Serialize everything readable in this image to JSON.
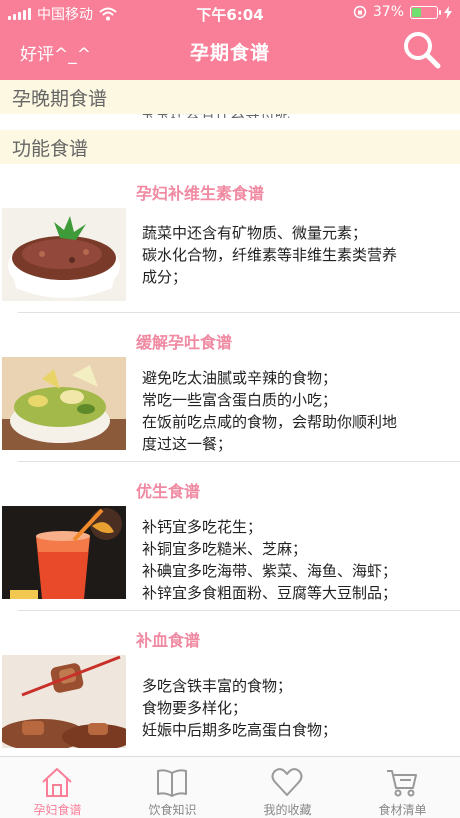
{
  "status_bar": {
    "carrier": "中国移动",
    "time": "下午6:04",
    "battery": "37%",
    "battery_level": 0.37
  },
  "nav": {
    "left_label": "好评^_^",
    "title": "孕期食谱",
    "search_icon": "search-icon"
  },
  "sections": [
    {
      "title": "孕晚期食谱",
      "peek": "宝宝还会有什么等待呢"
    },
    {
      "title": "功能食谱"
    }
  ],
  "items": [
    {
      "name": "孕妇补维生素食谱",
      "lines": [
        "蔬菜中还含有矿物质、微量元素；",
        "碳水化合物，纤维素等非维生素类营养",
        "成分；"
      ]
    },
    {
      "name": "缓解孕吐食谱",
      "lines": [
        "避免吃太油腻或辛辣的食物；",
        "常吃一些富含蛋白质的小吃；",
        "在饭前吃点咸的食物，会帮助你顺利地",
        "度过这一餐；"
      ]
    },
    {
      "name": "优生食谱",
      "lines": [
        "补钙宜多吃花生；",
        "补铜宜多吃糙米、芝麻；",
        "补碘宜多吃海带、紫菜、海鱼、海虾；",
        "补锌宜多食粗面粉、豆腐等大豆制品；"
      ]
    },
    {
      "name": "补血食谱",
      "lines": [
        "多吃含铁丰富的食物；",
        "食物要多样化；",
        "妊娠中后期多吃高蛋白食物；"
      ]
    }
  ],
  "tabs": [
    {
      "label": "孕妇食谱",
      "icon": "home-icon",
      "active": true
    },
    {
      "label": "饮食知识",
      "icon": "book-icon",
      "active": false
    },
    {
      "label": "我的收藏",
      "icon": "heart-icon",
      "active": false
    },
    {
      "label": "食材清单",
      "icon": "cart-icon",
      "active": false
    }
  ],
  "colors": {
    "accent": "#f97f98",
    "item_title": "#f08aa2",
    "section_bg": "#fdf8e2"
  }
}
